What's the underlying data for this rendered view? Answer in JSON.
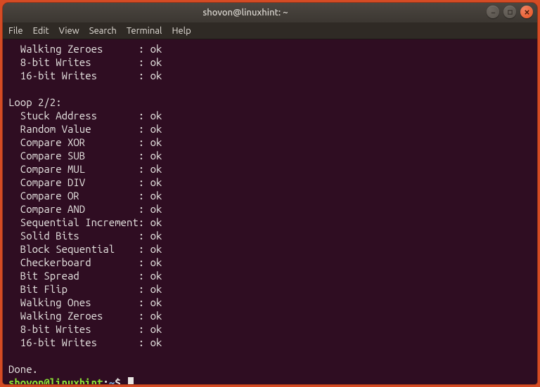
{
  "window": {
    "title": "shovon@linuxhint: ~"
  },
  "menubar": {
    "items": [
      "File",
      "Edit",
      "View",
      "Search",
      "Terminal",
      "Help"
    ]
  },
  "preloop_tests": [
    {
      "name": "Walking Zeroes",
      "status": "ok"
    },
    {
      "name": "8-bit Writes",
      "status": "ok"
    },
    {
      "name": "16-bit Writes",
      "status": "ok"
    }
  ],
  "loop_header": "Loop 2/2:",
  "loop_tests": [
    {
      "name": "Stuck Address",
      "status": "ok"
    },
    {
      "name": "Random Value",
      "status": "ok"
    },
    {
      "name": "Compare XOR",
      "status": "ok"
    },
    {
      "name": "Compare SUB",
      "status": "ok"
    },
    {
      "name": "Compare MUL",
      "status": "ok"
    },
    {
      "name": "Compare DIV",
      "status": "ok"
    },
    {
      "name": "Compare OR",
      "status": "ok"
    },
    {
      "name": "Compare AND",
      "status": "ok"
    },
    {
      "name": "Sequential Increment",
      "status": "ok"
    },
    {
      "name": "Solid Bits",
      "status": "ok"
    },
    {
      "name": "Block Sequential",
      "status": "ok"
    },
    {
      "name": "Checkerboard",
      "status": "ok"
    },
    {
      "name": "Bit Spread",
      "status": "ok"
    },
    {
      "name": "Bit Flip",
      "status": "ok"
    },
    {
      "name": "Walking Ones",
      "status": "ok"
    },
    {
      "name": "Walking Zeroes",
      "status": "ok"
    },
    {
      "name": "8-bit Writes",
      "status": "ok"
    },
    {
      "name": "16-bit Writes",
      "status": "ok"
    }
  ],
  "done_line": "Done.",
  "prompt": {
    "user_host": "shovon@linuxhint",
    "colon": ":",
    "path": "~",
    "symbol": "$"
  }
}
